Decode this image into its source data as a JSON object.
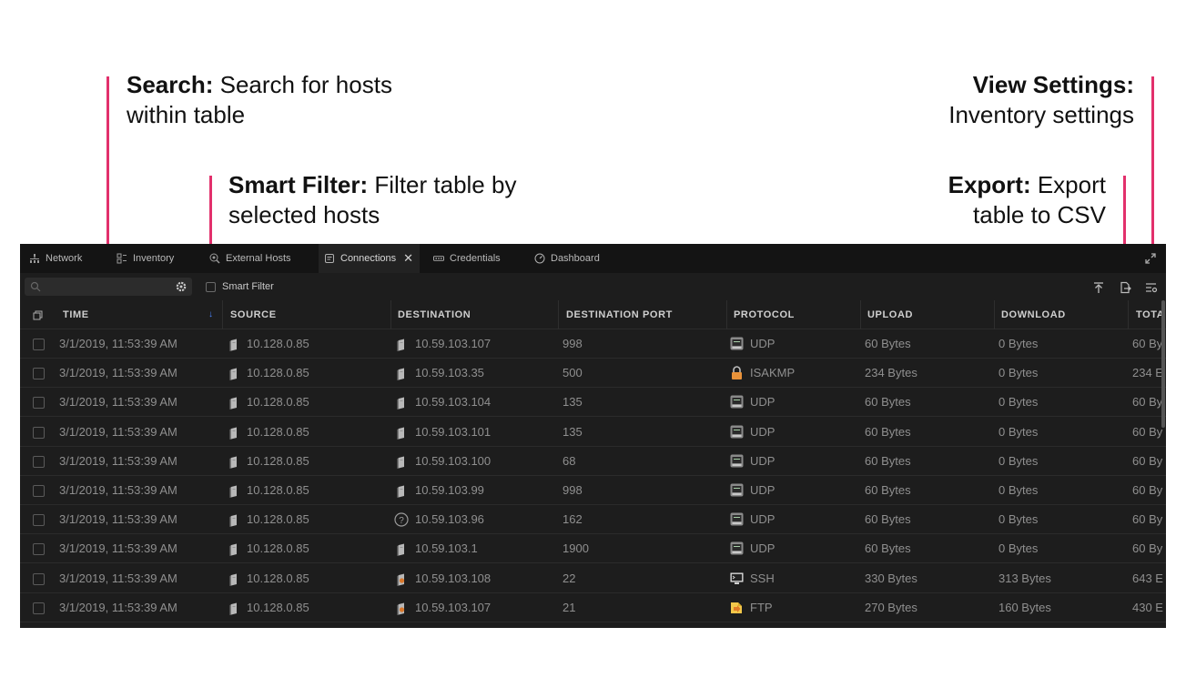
{
  "annotations": [
    {
      "id": "search",
      "title": "Search:",
      "text": "Search for hosts",
      "text2": "within table"
    },
    {
      "id": "smart-filter",
      "title": "Smart Filter:",
      "text": "Filter table by",
      "text2": "selected hosts"
    },
    {
      "id": "view-settings",
      "title": "View Settings:",
      "text2": "Inventory settings"
    },
    {
      "id": "export",
      "title": "Export:",
      "text": "Export",
      "text2": "table to CSV"
    }
  ],
  "tabs": [
    {
      "label": "Network",
      "icon": "network-icon"
    },
    {
      "label": "Inventory",
      "icon": "inventory-icon"
    },
    {
      "label": "External Hosts",
      "icon": "external-hosts-icon"
    },
    {
      "label": "Connections",
      "icon": "connections-icon",
      "active": true,
      "close": "✕"
    },
    {
      "label": "Credentials",
      "icon": "credentials-icon"
    },
    {
      "label": "Dashboard",
      "icon": "dashboard-icon"
    }
  ],
  "toolbar": {
    "search_placeholder": "",
    "smart_filter_label": "Smart Filter"
  },
  "columns": [
    "TIME",
    "SOURCE",
    "DESTINATION",
    "DESTINATION PORT",
    "PROTOCOL",
    "UPLOAD",
    "DOWNLOAD",
    "TOTA"
  ],
  "rows": [
    {
      "time": "3/1/2019, 11:53:39 AM",
      "source": "10.128.0.85",
      "destination": "10.59.103.107",
      "dest_icon": "host",
      "port": "998",
      "protocol": "UDP",
      "proto_icon": "udp-icon",
      "upload": "60 Bytes",
      "download": "0 Bytes",
      "total": "60 By"
    },
    {
      "time": "3/1/2019, 11:53:39 AM",
      "source": "10.128.0.85",
      "destination": "10.59.103.35",
      "dest_icon": "host",
      "port": "500",
      "protocol": "ISAKMP",
      "proto_icon": "lock-icon",
      "upload": "234 Bytes",
      "download": "0 Bytes",
      "total": "234 E"
    },
    {
      "time": "3/1/2019, 11:53:39 AM",
      "source": "10.128.0.85",
      "destination": "10.59.103.104",
      "dest_icon": "host",
      "port": "135",
      "protocol": "UDP",
      "proto_icon": "udp-icon",
      "upload": "60 Bytes",
      "download": "0 Bytes",
      "total": "60 By"
    },
    {
      "time": "3/1/2019, 11:53:39 AM",
      "source": "10.128.0.85",
      "destination": "10.59.103.101",
      "dest_icon": "host",
      "port": "135",
      "protocol": "UDP",
      "proto_icon": "udp-icon",
      "upload": "60 Bytes",
      "download": "0 Bytes",
      "total": "60 By"
    },
    {
      "time": "3/1/2019, 11:53:39 AM",
      "source": "10.128.0.85",
      "destination": "10.59.103.100",
      "dest_icon": "host",
      "port": "68",
      "protocol": "UDP",
      "proto_icon": "udp-icon",
      "upload": "60 Bytes",
      "download": "0 Bytes",
      "total": "60 By"
    },
    {
      "time": "3/1/2019, 11:53:39 AM",
      "source": "10.128.0.85",
      "destination": "10.59.103.99",
      "dest_icon": "host",
      "port": "998",
      "protocol": "UDP",
      "proto_icon": "udp-icon",
      "upload": "60 Bytes",
      "download": "0 Bytes",
      "total": "60 By"
    },
    {
      "time": "3/1/2019, 11:53:39 AM",
      "source": "10.128.0.85",
      "destination": "10.59.103.96",
      "dest_icon": "unknown",
      "port": "162",
      "protocol": "UDP",
      "proto_icon": "udp-icon",
      "upload": "60 Bytes",
      "download": "0 Bytes",
      "total": "60 By"
    },
    {
      "time": "3/1/2019, 11:53:39 AM",
      "source": "10.128.0.85",
      "destination": "10.59.103.1",
      "dest_icon": "host",
      "port": "1900",
      "protocol": "UDP",
      "proto_icon": "udp-icon",
      "upload": "60 Bytes",
      "download": "0 Bytes",
      "total": "60 By"
    },
    {
      "time": "3/1/2019, 11:53:39 AM",
      "source": "10.128.0.85",
      "destination": "10.59.103.108",
      "dest_icon": "server",
      "port": "22",
      "protocol": "SSH",
      "proto_icon": "terminal-icon",
      "upload": "330 Bytes",
      "download": "313 Bytes",
      "total": "643 E"
    },
    {
      "time": "3/1/2019, 11:53:39 AM",
      "source": "10.128.0.85",
      "destination": "10.59.103.107",
      "dest_icon": "server",
      "port": "21",
      "protocol": "FTP",
      "proto_icon": "ftp-icon",
      "upload": "270 Bytes",
      "download": "160 Bytes",
      "total": "430 E"
    }
  ],
  "colors": {
    "annotation_line": "#e2306c",
    "app_bg": "#1d1d1d",
    "sort_arrow": "#4a86ff",
    "lock_orange": "#e8923a",
    "server_orange": "#d9772b"
  }
}
